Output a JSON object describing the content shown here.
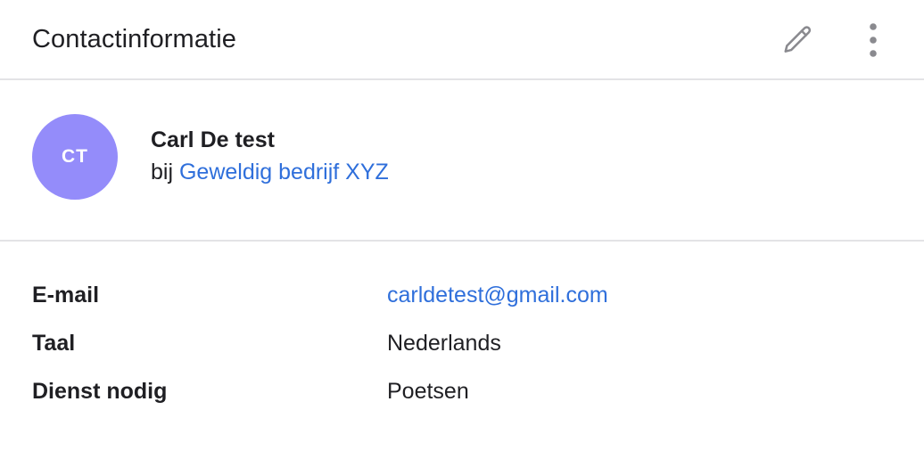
{
  "header": {
    "title": "Contactinformatie",
    "edit_icon": "pencil-icon",
    "menu_icon": "more-vertical-icon"
  },
  "contact": {
    "initials": "CT",
    "name": "Carl De test",
    "company_prefix": "bij",
    "company": "Geweldig bedrijf XYZ"
  },
  "details": [
    {
      "label": "E-mail",
      "value": "carldetest@gmail.com",
      "is_link": true
    },
    {
      "label": "Taal",
      "value": "Nederlands",
      "is_link": false
    },
    {
      "label": "Dienst nodig",
      "value": "Poetsen",
      "is_link": false
    }
  ],
  "colors": {
    "avatar_bg": "#948cfa",
    "link": "#2f6fdb",
    "icon": "#8a8a8f",
    "divider": "#e3e3e6"
  }
}
